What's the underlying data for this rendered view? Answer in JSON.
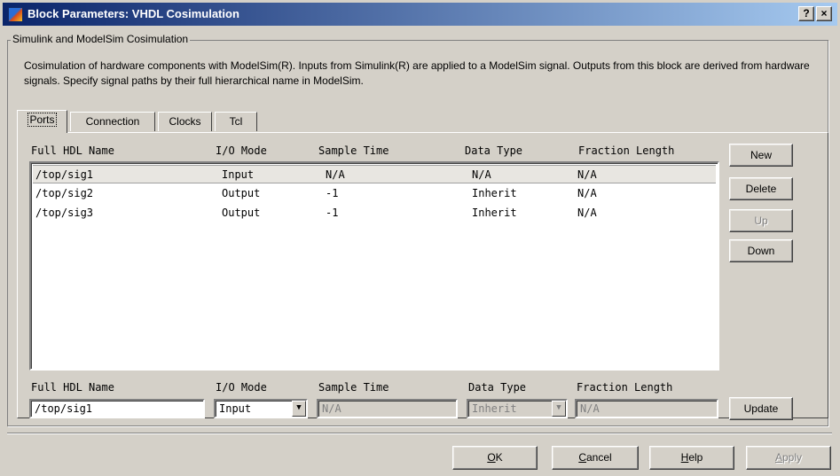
{
  "window": {
    "title": "Block Parameters: VHDL Cosimulation",
    "help_glyph": "?",
    "close_glyph": "×",
    "icon": "simulink-block-icon"
  },
  "group": {
    "legend": "Simulink and ModelSim Cosimulation",
    "description": "Cosimulation of hardware components with ModelSim(R). Inputs from Simulink(R) are applied to a ModelSim signal. Outputs from this block are derived from hardware signals. Specify signal paths by their full hierarchical name in ModelSim."
  },
  "tabs": [
    {
      "label": "Ports",
      "active": true
    },
    {
      "label": "Connection",
      "active": false
    },
    {
      "label": "Clocks",
      "active": false
    },
    {
      "label": "Tcl",
      "active": false
    }
  ],
  "columns": [
    "Full HDL Name",
    "I/O Mode",
    "Sample Time",
    "Data Type",
    "Fraction Length"
  ],
  "rows": [
    {
      "name": "/top/sig1",
      "mode": "Input",
      "sample": "N/A",
      "type": "N/A",
      "fraction": "N/A",
      "selected": true
    },
    {
      "name": "/top/sig2",
      "mode": "Output",
      "sample": "-1",
      "type": "Inherit",
      "fraction": "N/A",
      "selected": false
    },
    {
      "name": "/top/sig3",
      "mode": "Output",
      "sample": "-1",
      "type": "Inherit",
      "fraction": "N/A",
      "selected": false
    }
  ],
  "side_buttons": {
    "new": "New",
    "delete": "Delete",
    "up": "Up",
    "down": "Down"
  },
  "editor": {
    "name_value": "/top/sig1",
    "mode_value": "Input",
    "sample_value": "N/A",
    "type_value": "Inherit",
    "fraction_value": "N/A",
    "update_label": "Update"
  },
  "footer": {
    "ok": {
      "mnemonic": "O",
      "rest": "K"
    },
    "cancel": {
      "mnemonic": "C",
      "rest": "ancel"
    },
    "help": {
      "mnemonic": "H",
      "rest": "elp"
    },
    "apply": {
      "mnemonic": "A",
      "rest": "pply"
    }
  },
  "colors": {
    "face": "#d4d0c8",
    "title_start": "#0a246a",
    "title_end": "#a6caf0",
    "disabled_text": "#808080"
  }
}
